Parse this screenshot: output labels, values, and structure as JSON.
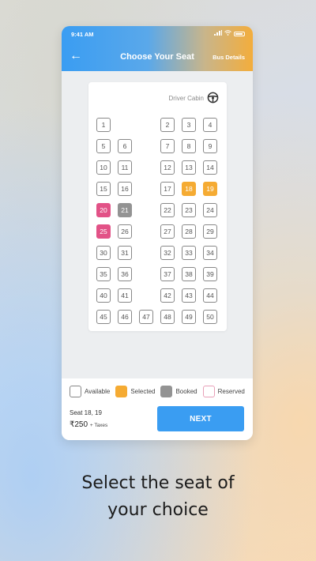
{
  "status_bar": {
    "time": "9:41 AM"
  },
  "header": {
    "title": "Choose Your Seat",
    "bus_details_label": "Bus Details",
    "back_glyph": "←"
  },
  "layout": {
    "driver_cabin_label": "Driver Cabin",
    "seats": [
      {
        "n": "1",
        "status": "available"
      },
      {
        "n": "2",
        "status": "available"
      },
      {
        "n": "3",
        "status": "available"
      },
      {
        "n": "4",
        "status": "available"
      },
      {
        "n": "5",
        "status": "available"
      },
      {
        "n": "6",
        "status": "available"
      },
      {
        "n": "7",
        "status": "available"
      },
      {
        "n": "8",
        "status": "available"
      },
      {
        "n": "9",
        "status": "available"
      },
      {
        "n": "10",
        "status": "available"
      },
      {
        "n": "11",
        "status": "available"
      },
      {
        "n": "12",
        "status": "available"
      },
      {
        "n": "13",
        "status": "available"
      },
      {
        "n": "14",
        "status": "available"
      },
      {
        "n": "15",
        "status": "available"
      },
      {
        "n": "16",
        "status": "available"
      },
      {
        "n": "17",
        "status": "available"
      },
      {
        "n": "18",
        "status": "selected"
      },
      {
        "n": "19",
        "status": "selected"
      },
      {
        "n": "20",
        "status": "reserved"
      },
      {
        "n": "21",
        "status": "booked"
      },
      {
        "n": "22",
        "status": "available"
      },
      {
        "n": "23",
        "status": "available"
      },
      {
        "n": "24",
        "status": "available"
      },
      {
        "n": "25",
        "status": "reserved"
      },
      {
        "n": "26",
        "status": "available"
      },
      {
        "n": "27",
        "status": "available"
      },
      {
        "n": "28",
        "status": "available"
      },
      {
        "n": "29",
        "status": "available"
      },
      {
        "n": "30",
        "status": "available"
      },
      {
        "n": "31",
        "status": "available"
      },
      {
        "n": "32",
        "status": "available"
      },
      {
        "n": "33",
        "status": "available"
      },
      {
        "n": "34",
        "status": "available"
      },
      {
        "n": "35",
        "status": "available"
      },
      {
        "n": "36",
        "status": "available"
      },
      {
        "n": "37",
        "status": "available"
      },
      {
        "n": "38",
        "status": "available"
      },
      {
        "n": "39",
        "status": "available"
      },
      {
        "n": "40",
        "status": "available"
      },
      {
        "n": "41",
        "status": "available"
      },
      {
        "n": "42",
        "status": "available"
      },
      {
        "n": "43",
        "status": "available"
      },
      {
        "n": "44",
        "status": "available"
      },
      {
        "n": "45",
        "status": "available"
      },
      {
        "n": "46",
        "status": "available"
      },
      {
        "n": "47",
        "status": "available"
      },
      {
        "n": "48",
        "status": "available"
      },
      {
        "n": "49",
        "status": "available"
      },
      {
        "n": "50",
        "status": "available"
      }
    ]
  },
  "legend": {
    "available": "Available",
    "selected": "Selected",
    "booked": "Booked",
    "reserved": "Reserved"
  },
  "summary": {
    "seats_label": "Seat 18, 19",
    "price": "₹250",
    "taxes": "+ Taxes"
  },
  "next_button_label": "NEXT",
  "tagline": {
    "line1": "Select the seat of",
    "line2": "your choice"
  },
  "colors": {
    "primary": "#3a9df2",
    "selected": "#f5ab33",
    "booked": "#939393",
    "reserved": "#e25287"
  },
  "icons": {
    "back": "arrow-left-icon",
    "driver": "steering-wheel-icon"
  }
}
